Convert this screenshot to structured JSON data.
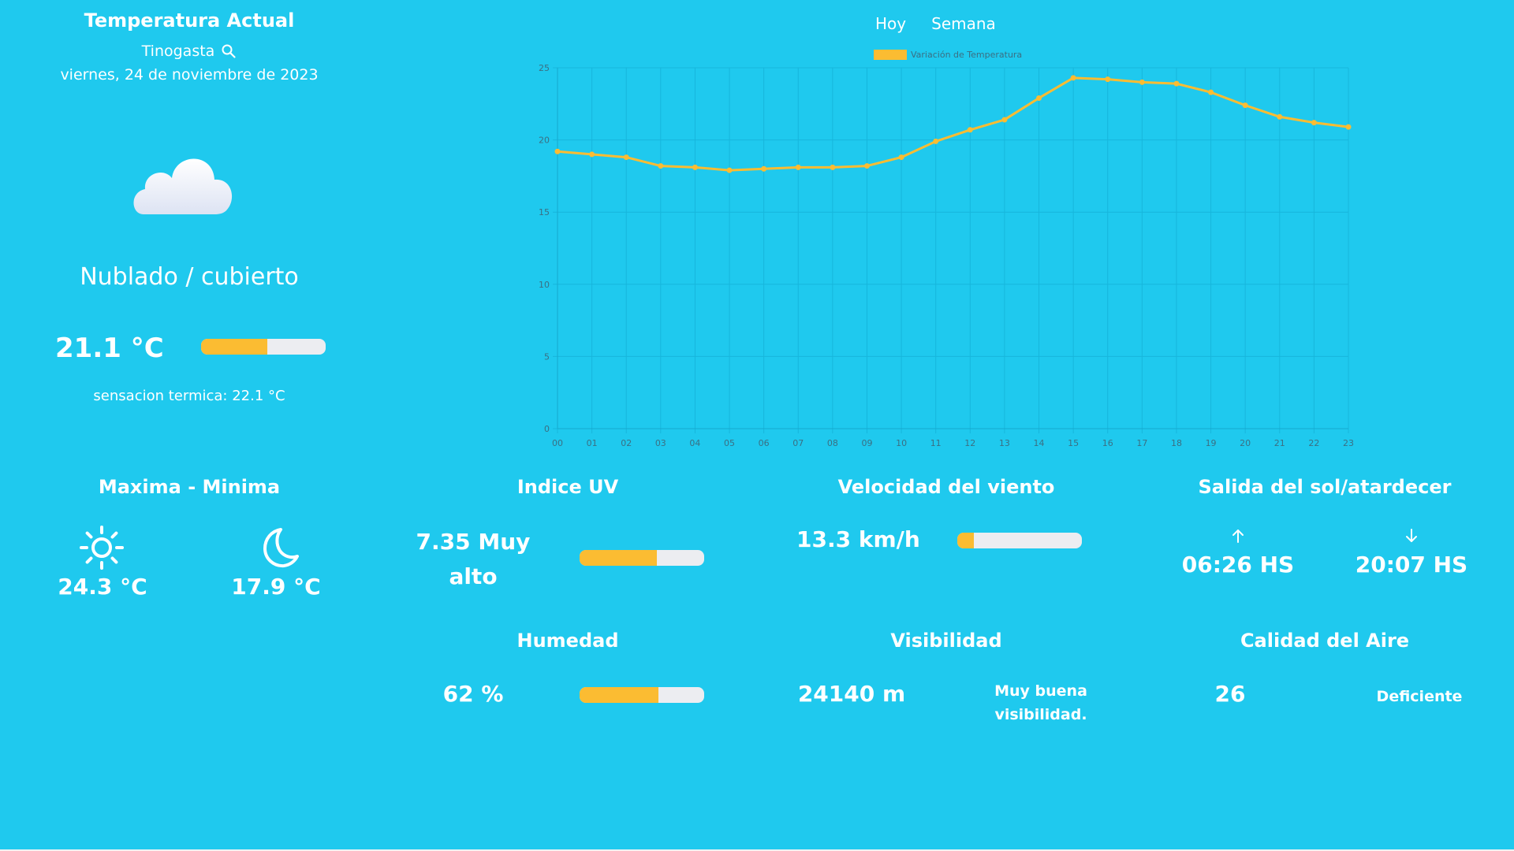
{
  "current": {
    "title": "Temperatura Actual",
    "location": "Tinogasta",
    "date": "viernes, 24 de noviembre de 2023",
    "condition": "Nublado / cubierto",
    "temperature": "21.1 °C",
    "temperature_bar_fraction": 0.53,
    "feels_like": "sensacion termica: 22.1 °C",
    "icons": {
      "search": "search-icon",
      "weather": "cloud-icon"
    }
  },
  "tabs": [
    "Hoy",
    "Semana"
  ],
  "chart_data": {
    "type": "line",
    "title": "",
    "xlabel": "",
    "ylabel": "",
    "x": [
      "00",
      "01",
      "02",
      "03",
      "04",
      "05",
      "06",
      "07",
      "08",
      "09",
      "10",
      "11",
      "12",
      "13",
      "14",
      "15",
      "16",
      "17",
      "18",
      "19",
      "20",
      "21",
      "22",
      "23"
    ],
    "series": [
      {
        "name": "Variación de Temperatura",
        "values": [
          19.2,
          19.0,
          18.8,
          18.2,
          18.1,
          17.9,
          18.0,
          18.1,
          18.1,
          18.2,
          18.8,
          19.9,
          20.7,
          21.4,
          22.9,
          24.3,
          24.2,
          24.0,
          23.9,
          23.3,
          22.4,
          21.6,
          21.2,
          20.9
        ]
      }
    ],
    "yticks": [
      0,
      5,
      10,
      15,
      20,
      25
    ],
    "ylim": [
      0,
      25
    ],
    "grid": true,
    "legend": "top-center",
    "color": "#fbbc32"
  },
  "maxmin": {
    "title": "Maxima - Minima",
    "max": "24.3 °C",
    "min": "17.9 °C",
    "icons": {
      "max": "sun-icon",
      "min": "moon-icon"
    }
  },
  "uv": {
    "title": "Indice UV",
    "value": "7.35 Muy alto",
    "bar_fraction": 0.62
  },
  "wind": {
    "title": "Velocidad del viento",
    "value": "13.3 km/h",
    "bar_fraction": 0.13
  },
  "sun": {
    "title": "Salida del sol/atardecer",
    "sunrise": "06:26 HS",
    "sunset": "20:07 HS",
    "icons": {
      "sunrise": "arrow-up-icon",
      "sunset": "arrow-down-icon"
    }
  },
  "humidity": {
    "title": "Humedad",
    "value": "62 %",
    "bar_fraction": 0.63
  },
  "visibility": {
    "title": "Visibilidad",
    "value": "24140 m",
    "text": "Muy buena visibilidad."
  },
  "air": {
    "title": "Calidad del Aire",
    "value": "26",
    "text": "Deficiente"
  },
  "colors": {
    "background": "#1fc9ee",
    "accent": "#fbbc32",
    "bar_track": "#ecedf1"
  }
}
